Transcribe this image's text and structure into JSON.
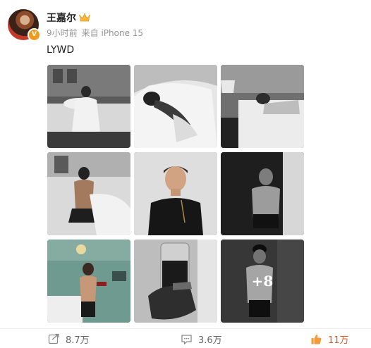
{
  "user": {
    "name": "王嘉尔",
    "verified_badge": "V",
    "time": "9小时前",
    "source": "来自 iPhone 15"
  },
  "post": {
    "text": "LYWD",
    "images_more": "+8"
  },
  "actions": {
    "repost_count": "8.7万",
    "comment_count": "3.6万",
    "like_count": "11万"
  },
  "colors": {
    "like_accent": "#e8591b",
    "badge": "#f29a1a"
  }
}
